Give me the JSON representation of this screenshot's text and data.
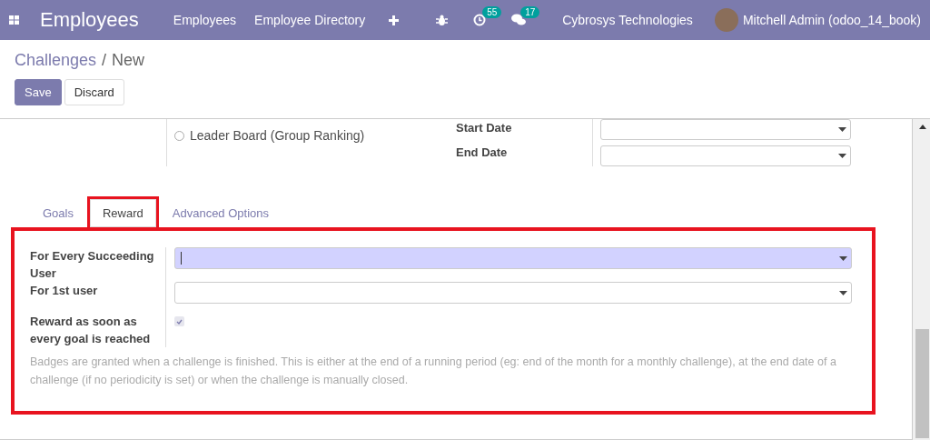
{
  "navbar": {
    "app_title": "Employees",
    "menu": [
      "Employees",
      "Employee Directory"
    ],
    "activity_count": "55",
    "message_count": "17",
    "company": "Cybrosys Technologies",
    "user": "Mitchell Admin (odoo_14_book)"
  },
  "breadcrumb": {
    "items": [
      "Challenges",
      "New"
    ],
    "separator": "/"
  },
  "buttons": [
    {
      "label": "Save",
      "kind": "primary"
    },
    {
      "label": "Discard",
      "kind": "secondary"
    }
  ],
  "header": {
    "radio": {
      "label": "Leader Board (Group Ranking)",
      "selected": false
    },
    "dates": [
      {
        "label": "Start Date"
      },
      {
        "label": "End Date"
      }
    ]
  },
  "tabs": [
    {
      "label": "Goals",
      "selected": false
    },
    {
      "label": "Reward",
      "selected": true
    },
    {
      "label": "Advanced Options",
      "selected": false
    }
  ],
  "reward_fields": [
    {
      "label": "For Every Succeeding User",
      "kind": "select",
      "focused": true
    },
    {
      "label": "For 1st user",
      "kind": "select",
      "focused": false
    },
    {
      "label": "Reward as soon as every goal is reached",
      "kind": "checkbox",
      "checked": true
    }
  ],
  "help_text": "Badges are granted when a challenge is finished. This is either at the end of a running period (eg: end of the month for a monthly challenge), at the end date of a challenge (if no periodicity is set) or when the challenge is manually closed."
}
